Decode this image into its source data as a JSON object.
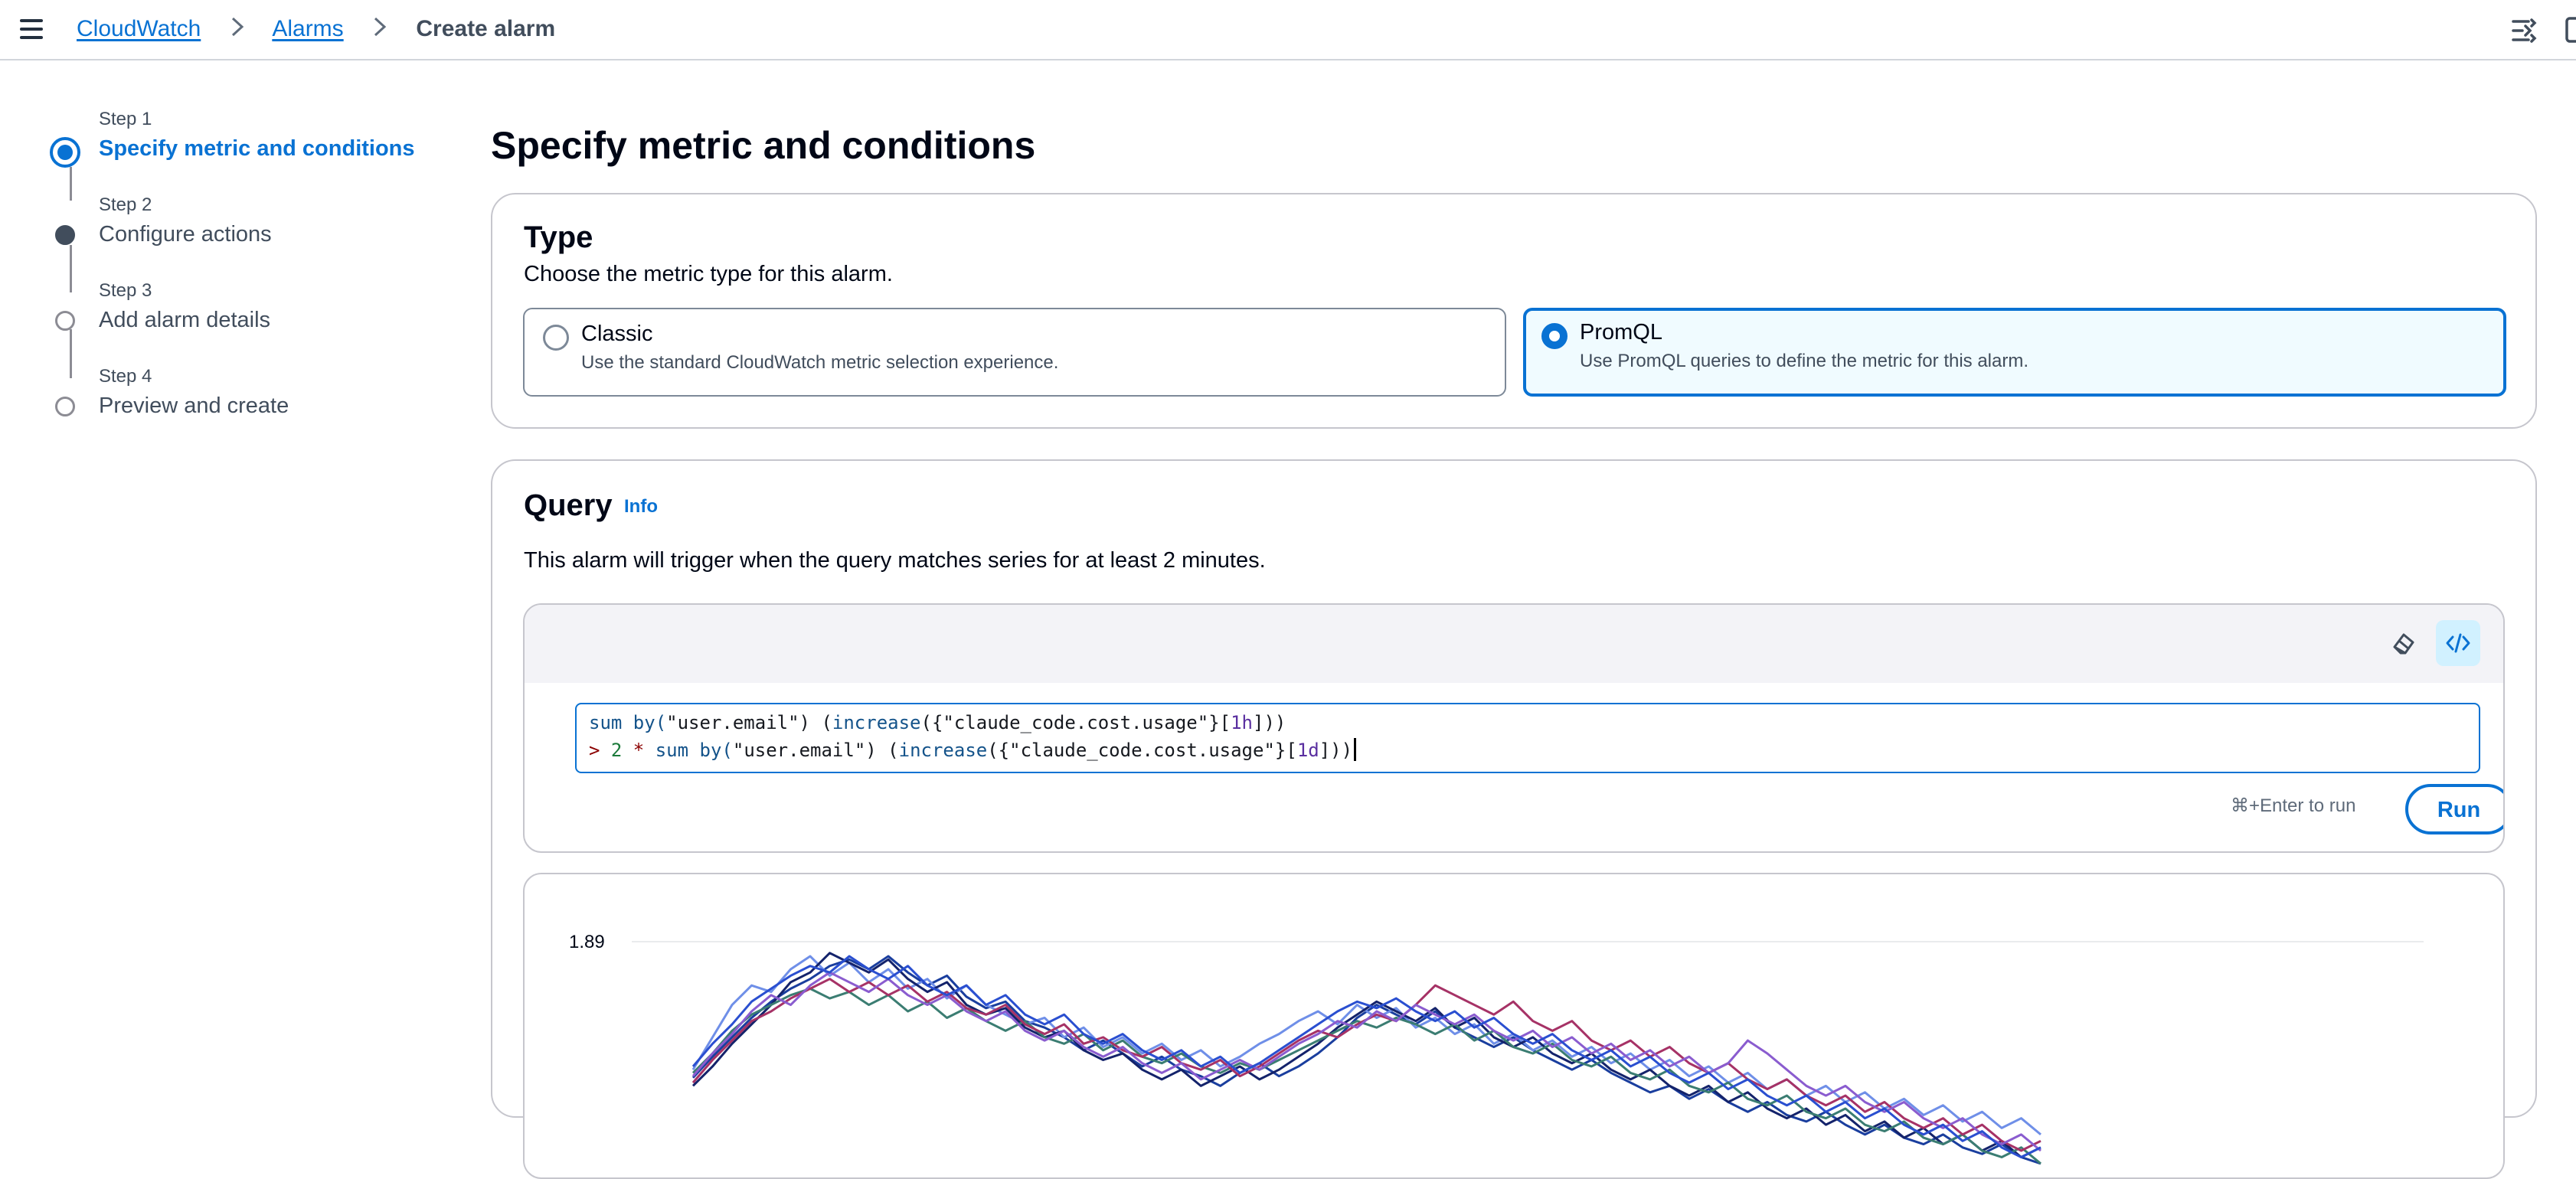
{
  "breadcrumb": {
    "items": [
      "CloudWatch",
      "Alarms"
    ],
    "current": "Create alarm"
  },
  "icons": {
    "menu": "hamburger-menu-icon",
    "split_panel": "split-panel-icon",
    "breadcrumb_separator": "chevron-right-icon",
    "editor_clear": "eraser-icon",
    "editor_code": "code-view-icon"
  },
  "steps": [
    {
      "number": "Step 1",
      "title": "Specify metric and conditions",
      "state": "current"
    },
    {
      "number": "Step 2",
      "title": "Configure actions",
      "state": "done"
    },
    {
      "number": "Step 3",
      "title": "Add alarm details",
      "state": "pending"
    },
    {
      "number": "Step 4",
      "title": "Preview and create",
      "state": "pending"
    }
  ],
  "page_title": "Specify metric and conditions",
  "type_section": {
    "heading": "Type",
    "description": "Choose the metric type for this alarm.",
    "options": [
      {
        "title": "Classic",
        "description": "Use the standard CloudWatch metric selection experience.",
        "selected": false
      },
      {
        "title": "PromQL",
        "description": "Use PromQL queries to define the metric for this alarm.",
        "selected": true
      }
    ]
  },
  "query_section": {
    "heading": "Query",
    "info_link": "Info",
    "description": "This alarm will trigger when the query matches series for at least 2 minutes.",
    "run_hint": "⌘+Enter to run",
    "run_button": "Run",
    "code": {
      "line1": [
        {
          "t": "sum by(",
          "c": "fn"
        },
        {
          "t": "\"user.email\"",
          "c": "str"
        },
        {
          "t": ") (",
          "c": "plain"
        },
        {
          "t": "increase",
          "c": "fn"
        },
        {
          "t": "({",
          "c": "plain"
        },
        {
          "t": "\"claude_code.cost.usage\"",
          "c": "str"
        },
        {
          "t": "}[",
          "c": "plain"
        },
        {
          "t": "1h",
          "c": "dur"
        },
        {
          "t": "]))",
          "c": "plain"
        }
      ],
      "line2": [
        {
          "t": "> ",
          "c": "op"
        },
        {
          "t": "2",
          "c": "num"
        },
        {
          "t": " * ",
          "c": "op"
        },
        {
          "t": "sum by(",
          "c": "fn"
        },
        {
          "t": "\"user.email\"",
          "c": "str"
        },
        {
          "t": ") (",
          "c": "plain"
        },
        {
          "t": "increase",
          "c": "fn"
        },
        {
          "t": "({",
          "c": "plain"
        },
        {
          "t": "\"claude_code.cost.usage\"",
          "c": "str"
        },
        {
          "t": "}[",
          "c": "plain"
        },
        {
          "t": "1d",
          "c": "dur"
        },
        {
          "t": "]))",
          "c": "plain"
        }
      ]
    }
  },
  "colors": {
    "accent": "#0972d3",
    "series": [
      "#1a3e9e",
      "#6f8fe8",
      "#14236b",
      "#3b7d72",
      "#a63266",
      "#8a5ccf",
      "#2a4fd0"
    ]
  },
  "chart_data": {
    "type": "line",
    "ytick_labels": [
      "1.89"
    ],
    "ylim": [
      0,
      1.89
    ],
    "grid": true,
    "x": [
      0,
      1,
      2,
      3,
      4,
      5,
      6,
      7,
      8,
      9,
      10,
      11,
      12,
      13,
      14,
      15,
      16,
      17,
      18,
      19,
      20,
      21,
      22,
      23,
      24,
      25,
      26,
      27,
      28,
      29,
      30,
      31,
      32,
      33,
      34,
      35,
      36,
      37,
      38,
      39,
      40,
      41,
      42,
      43,
      44,
      45,
      46,
      47,
      48,
      49,
      50,
      51,
      52,
      53,
      54,
      55,
      56,
      57,
      58,
      59,
      60,
      61,
      62,
      63,
      64,
      65,
      66,
      67,
      68,
      69
    ],
    "series": [
      {
        "values": [
          1.05,
          1.18,
          1.3,
          1.42,
          1.52,
          1.6,
          1.66,
          1.74,
          1.78,
          1.72,
          1.8,
          1.7,
          1.62,
          1.68,
          1.55,
          1.48,
          1.52,
          1.4,
          1.36,
          1.3,
          1.22,
          1.28,
          1.2,
          1.12,
          1.18,
          1.1,
          1.06,
          1.0,
          1.08,
          1.14,
          1.06,
          1.12,
          1.2,
          1.3,
          1.42,
          1.5,
          1.44,
          1.38,
          1.46,
          1.36,
          1.3,
          1.24,
          1.3,
          1.22,
          1.16,
          1.1,
          1.16,
          1.08,
          1.02,
          0.96,
          1.0,
          0.92,
          0.98,
          0.9,
          0.84,
          0.9,
          0.82,
          0.78,
          0.84,
          0.76,
          0.7,
          0.76,
          0.68,
          0.64,
          0.7,
          0.62,
          0.58,
          0.64,
          0.56,
          0.52
        ]
      },
      {
        "values": [
          1.1,
          1.3,
          1.5,
          1.62,
          1.58,
          1.72,
          1.8,
          1.68,
          1.76,
          1.64,
          1.72,
          1.6,
          1.66,
          1.54,
          1.62,
          1.5,
          1.44,
          1.38,
          1.42,
          1.3,
          1.36,
          1.24,
          1.3,
          1.2,
          1.26,
          1.16,
          1.22,
          1.12,
          1.18,
          1.26,
          1.32,
          1.4,
          1.46,
          1.38,
          1.5,
          1.42,
          1.48,
          1.36,
          1.42,
          1.32,
          1.38,
          1.26,
          1.32,
          1.22,
          1.28,
          1.18,
          1.24,
          1.14,
          1.2,
          1.1,
          1.16,
          1.06,
          1.12,
          1.02,
          1.08,
          0.98,
          1.04,
          0.94,
          1.0,
          0.9,
          0.96,
          0.86,
          0.92,
          0.82,
          0.88,
          0.78,
          0.84,
          0.74,
          0.8,
          0.7
        ]
      },
      {
        "values": [
          1.0,
          1.12,
          1.26,
          1.38,
          1.5,
          1.64,
          1.7,
          1.82,
          1.76,
          1.7,
          1.78,
          1.66,
          1.58,
          1.64,
          1.5,
          1.44,
          1.48,
          1.36,
          1.3,
          1.34,
          1.22,
          1.16,
          1.2,
          1.1,
          1.04,
          1.1,
          1.0,
          1.06,
          1.12,
          1.04,
          1.1,
          1.18,
          1.26,
          1.36,
          1.44,
          1.52,
          1.46,
          1.4,
          1.48,
          1.36,
          1.42,
          1.3,
          1.24,
          1.3,
          1.2,
          1.14,
          1.2,
          1.1,
          1.04,
          1.1,
          1.0,
          0.94,
          1.0,
          0.9,
          0.96,
          0.86,
          0.8,
          0.86,
          0.76,
          0.82,
          0.72,
          0.78,
          0.68,
          0.74,
          0.64,
          0.7,
          0.6,
          0.66,
          0.56,
          0.62
        ]
      },
      {
        "values": [
          1.08,
          1.2,
          1.34,
          1.44,
          1.5,
          1.56,
          1.6,
          1.54,
          1.58,
          1.5,
          1.56,
          1.46,
          1.52,
          1.42,
          1.48,
          1.4,
          1.34,
          1.4,
          1.3,
          1.26,
          1.32,
          1.22,
          1.28,
          1.18,
          1.14,
          1.2,
          1.12,
          1.08,
          1.14,
          1.1,
          1.16,
          1.22,
          1.28,
          1.34,
          1.4,
          1.36,
          1.42,
          1.38,
          1.32,
          1.38,
          1.28,
          1.34,
          1.24,
          1.2,
          1.26,
          1.16,
          1.12,
          1.18,
          1.08,
          1.04,
          1.1,
          1.0,
          0.96,
          1.02,
          0.92,
          0.88,
          0.94,
          0.84,
          0.8,
          0.86,
          0.76,
          0.72,
          0.78,
          0.68,
          0.64,
          0.7,
          0.6,
          0.56,
          0.62,
          0.52
        ]
      },
      {
        "values": [
          1.02,
          1.16,
          1.28,
          1.4,
          1.46,
          1.54,
          1.6,
          1.66,
          1.58,
          1.64,
          1.56,
          1.62,
          1.52,
          1.58,
          1.48,
          1.44,
          1.5,
          1.38,
          1.32,
          1.38,
          1.26,
          1.3,
          1.22,
          1.18,
          1.24,
          1.14,
          1.1,
          1.16,
          1.06,
          1.12,
          1.2,
          1.28,
          1.34,
          1.3,
          1.38,
          1.44,
          1.4,
          1.5,
          1.62,
          1.56,
          1.5,
          1.44,
          1.52,
          1.4,
          1.34,
          1.4,
          1.28,
          1.22,
          1.28,
          1.18,
          1.24,
          1.14,
          1.08,
          1.14,
          1.04,
          0.98,
          1.04,
          0.94,
          0.88,
          0.94,
          0.84,
          0.9,
          0.8,
          0.74,
          0.8,
          0.7,
          0.76,
          0.66,
          0.6,
          0.66
        ]
      },
      {
        "values": [
          1.06,
          1.2,
          1.32,
          1.46,
          1.56,
          1.5,
          1.62,
          1.7,
          1.64,
          1.58,
          1.66,
          1.56,
          1.5,
          1.56,
          1.46,
          1.4,
          1.46,
          1.34,
          1.28,
          1.34,
          1.24,
          1.18,
          1.24,
          1.14,
          1.08,
          1.14,
          1.04,
          1.1,
          1.16,
          1.1,
          1.18,
          1.26,
          1.32,
          1.4,
          1.36,
          1.46,
          1.4,
          1.5,
          1.44,
          1.38,
          1.44,
          1.34,
          1.28,
          1.34,
          1.24,
          1.3,
          1.2,
          1.26,
          1.16,
          1.22,
          1.12,
          1.18,
          1.08,
          1.14,
          1.28,
          1.2,
          1.1,
          1.0,
          0.94,
          1.0,
          0.9,
          0.84,
          0.9,
          0.8,
          0.74,
          0.8,
          0.7,
          0.64,
          0.7,
          0.6
        ]
      },
      {
        "values": [
          1.12,
          1.26,
          1.38,
          1.52,
          1.6,
          1.68,
          1.74,
          1.7,
          1.8,
          1.72,
          1.66,
          1.74,
          1.62,
          1.56,
          1.62,
          1.5,
          1.56,
          1.44,
          1.38,
          1.44,
          1.32,
          1.26,
          1.32,
          1.22,
          1.16,
          1.22,
          1.12,
          1.18,
          1.08,
          1.14,
          1.22,
          1.3,
          1.38,
          1.46,
          1.52,
          1.48,
          1.54,
          1.46,
          1.4,
          1.46,
          1.36,
          1.42,
          1.32,
          1.26,
          1.32,
          1.22,
          1.16,
          1.22,
          1.12,
          1.18,
          1.08,
          1.02,
          1.08,
          0.98,
          1.04,
          0.94,
          0.88,
          0.94,
          0.84,
          0.9,
          0.8,
          0.86,
          0.76,
          0.7,
          0.76,
          0.66,
          0.72,
          0.62,
          0.56,
          0.62
        ]
      }
    ]
  }
}
